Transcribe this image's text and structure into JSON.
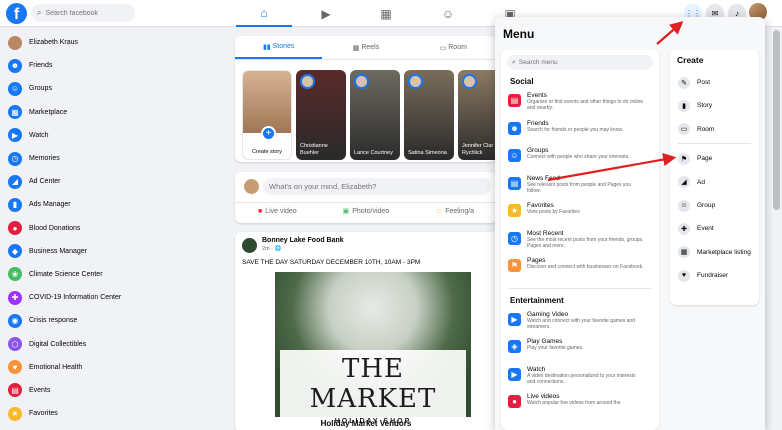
{
  "topbar": {
    "logo": "f",
    "search_placeholder": "Search facebook",
    "nav_icons": [
      "home-icon",
      "watch-icon",
      "marketplace-icon",
      "groups-icon",
      "gaming-icon"
    ],
    "actions": [
      "menu-grid-icon",
      "messenger-icon",
      "notifications-icon"
    ]
  },
  "sidebar": {
    "items": [
      {
        "label": "Elizabeth Kraus",
        "icon": "avatar",
        "color": "#b88763"
      },
      {
        "label": "Friends",
        "icon": "friends-icon",
        "color": "#1877f2"
      },
      {
        "label": "Groups",
        "icon": "groups-icon",
        "color": "#1877f2"
      },
      {
        "label": "Marketplace",
        "icon": "marketplace-icon",
        "color": "#1877f2"
      },
      {
        "label": "Watch",
        "icon": "watch-icon",
        "color": "#1877f2"
      },
      {
        "label": "Memories",
        "icon": "memories-icon",
        "color": "#1877f2"
      },
      {
        "label": "Ad Center",
        "icon": "ad-center-icon",
        "color": "#1877f2"
      },
      {
        "label": "Ads Manager",
        "icon": "ads-manager-icon",
        "color": "#1877f2"
      },
      {
        "label": "Blood Donations",
        "icon": "blood-icon",
        "color": "#e41e3f"
      },
      {
        "label": "Business Manager",
        "icon": "business-icon",
        "color": "#1877f2"
      },
      {
        "label": "Climate Science Center",
        "icon": "climate-icon",
        "color": "#45bd62"
      },
      {
        "label": "COVID-19 Information Center",
        "icon": "covid-icon",
        "color": "#a033ff"
      },
      {
        "label": "Crisis response",
        "icon": "crisis-icon",
        "color": "#1877f2"
      },
      {
        "label": "Digital Collectibles",
        "icon": "collectibles-icon",
        "color": "#8d54e8"
      },
      {
        "label": "Emotional Health",
        "icon": "health-icon",
        "color": "#f7923b"
      },
      {
        "label": "Events",
        "icon": "events-icon",
        "color": "#e41e3f"
      },
      {
        "label": "Favorites",
        "icon": "favorites-icon",
        "color": "#f7b928"
      }
    ]
  },
  "feed": {
    "stories_tab": "Stories",
    "reels_tab": "Reels",
    "rooms_tab": "Room",
    "create_story": "Create story",
    "stories": [
      {
        "name": "Christianne Buehler",
        "bg": "#5a2a2a"
      },
      {
        "name": "Lance Courtney",
        "bg": "#6d6a60"
      },
      {
        "name": "Satina Simeona",
        "bg": "#7a6d5c"
      },
      {
        "name": "Jennifer Clar Rychlick",
        "bg": "#8c7a63"
      }
    ],
    "composer_placeholder": "What's on your mind, Elizabeth?",
    "live_video": "Live video",
    "photo_video": "Photo/video",
    "feeling": "Feeling/a",
    "post": {
      "page": "Bonney Lake Food Bank",
      "time": "2m · 🌐",
      "text": "SAVE THE DAY SATURDAY DECEMBER 10TH, 10AM - 3PM",
      "image_title": "THE MARKET",
      "image_sub": "HOLIDAY SHOP",
      "footer": "Holiday Market Vendors"
    }
  },
  "menu": {
    "title": "Menu",
    "search_placeholder": "Search menu",
    "social_title": "Social",
    "social": [
      {
        "title": "Events",
        "desc": "Organize or find events and other things to do online and nearby.",
        "icon": "events-icon",
        "color": "#e41e3f"
      },
      {
        "title": "Friends",
        "desc": "Search for friends or people you may know.",
        "icon": "friends-icon",
        "color": "#1877f2"
      },
      {
        "title": "Groups",
        "desc": "Connect with people who share your interests.",
        "icon": "groups-icon",
        "color": "#1877f2"
      },
      {
        "title": "News Feed",
        "desc": "See relevant posts from people and Pages you follow.",
        "icon": "news-feed-icon",
        "color": "#1877f2"
      },
      {
        "title": "Favorites",
        "desc": "View posts by Favorites",
        "icon": "star-icon",
        "color": "#f7b928"
      },
      {
        "title": "Most Recent",
        "desc": "See the most recent posts from your friends, groups, Pages and more.",
        "icon": "most-recent-icon",
        "color": "#1877f2"
      },
      {
        "title": "Pages",
        "desc": "Discover and connect with businesses on Facebook.",
        "icon": "pages-icon",
        "color": "#f7923b"
      }
    ],
    "entertainment_title": "Entertainment",
    "entertainment": [
      {
        "title": "Gaming Video",
        "desc": "Watch and connect with your favorite games and streamers.",
        "icon": "gaming-video-icon",
        "color": "#1877f2"
      },
      {
        "title": "Play Games",
        "desc": "Play your favorite games.",
        "icon": "play-games-icon",
        "color": "#1877f2"
      },
      {
        "title": "Watch",
        "desc": "A video destination personalized to your interests and connections.",
        "icon": "watch-icon",
        "color": "#1877f2"
      },
      {
        "title": "Live videos",
        "desc": "Watch popular live videos from around the",
        "icon": "live-icon",
        "color": "#e41e3f"
      }
    ],
    "create_title": "Create",
    "create_top": [
      {
        "label": "Post",
        "icon": "post-icon"
      },
      {
        "label": "Story",
        "icon": "story-icon"
      },
      {
        "label": "Room",
        "icon": "room-icon"
      }
    ],
    "create_bottom": [
      {
        "label": "Page",
        "icon": "flag-icon"
      },
      {
        "label": "Ad",
        "icon": "megaphone-icon"
      },
      {
        "label": "Group",
        "icon": "group-icon"
      },
      {
        "label": "Event",
        "icon": "event-icon"
      },
      {
        "label": "Marketplace listing",
        "icon": "marketplace-listing-icon"
      },
      {
        "label": "Fundraiser",
        "icon": "fundraiser-icon"
      }
    ]
  },
  "colors": {
    "brand": "#1877f2",
    "arrow": "#e02020"
  }
}
